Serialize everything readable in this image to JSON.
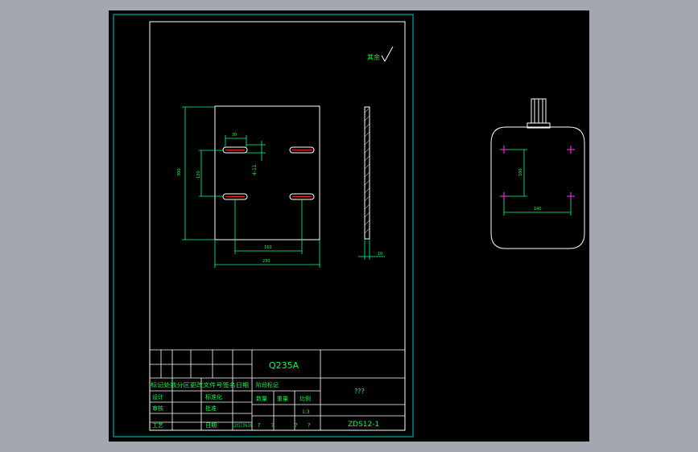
{
  "colors": {
    "background": "#a3a7b0",
    "viewport": "#000000",
    "frame": "#00c8c8",
    "paper": "#ffffff",
    "part": "#ffffff",
    "dimension": "#00ff7f",
    "slot": "#ff2020",
    "marker": "#ff33ff",
    "text": "#00ff40"
  },
  "drawing": {
    "roughness_mark": "其余",
    "material": "Q235A",
    "unknown_marks": [
      "???",
      "?",
      "?",
      "?",
      "?"
    ],
    "drawing_number": "ZDS12-1",
    "date": "2017.06.26",
    "scale": "1:3"
  },
  "dimensions": {
    "slot_width": "30",
    "slot_offset": "4-11",
    "vertical_spacing": "120",
    "plate_height": "300",
    "horizontal_spacing": "160",
    "plate_width": "230",
    "thickness": "10",
    "view_vertical": "100",
    "view_horizontal": "140"
  },
  "title_block": {
    "revision_header": "标记处数分区更改文件号签名日期",
    "designer": "设计",
    "standardization": "标准化",
    "checker": "审核",
    "process": "工艺",
    "approve": "批准",
    "date_label": "日期",
    "stage_mark": "阶段标记",
    "weight": "重量",
    "scale_label": "比例",
    "quantity": "数量",
    "sheet_info": "共张第张"
  }
}
